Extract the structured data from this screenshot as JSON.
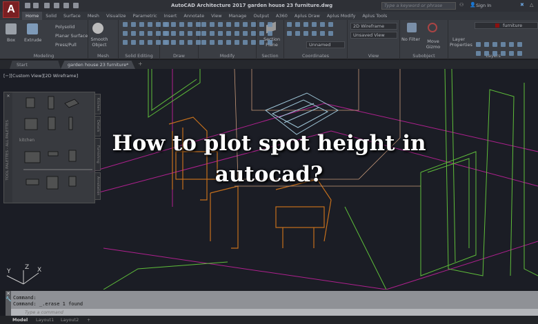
{
  "app": {
    "logo": "A",
    "title": "AutoCAD Architecture 2017   garden house 23 furniture.dwg",
    "search_placeholder": "Type a keyword or phrase",
    "sign_in": "Sign In"
  },
  "menu_tabs": [
    "Home",
    "Solid",
    "Surface",
    "Mesh",
    "Visualize",
    "Parametric",
    "Insert",
    "Annotate",
    "View",
    "Manage",
    "Output",
    "A360",
    "Aplus Draw",
    "Aplus Modify",
    "Aplus Tools"
  ],
  "ribbon": {
    "modeling": {
      "label": "Modeling",
      "box": "Box",
      "extrude": "Extrude",
      "polysolid": "Polysolid",
      "planar": "Planar Surface",
      "presspull": "Press/Pull"
    },
    "mesh": {
      "label": "Mesh",
      "smooth": "Smooth Object"
    },
    "solid_editing": {
      "label": "Solid Editing"
    },
    "draw": {
      "label": "Draw"
    },
    "modify": {
      "label": "Modify"
    },
    "section": {
      "label": "Section",
      "plane": "Section Plane"
    },
    "coordinates": {
      "label": "Coordinates",
      "ucs": "Unnamed"
    },
    "view": {
      "label": "View",
      "visual_style": "2D Wireframe",
      "named_view": "Unsaved View"
    },
    "subobject": {
      "label": "Subobject",
      "no_filter": "No Filter",
      "move_gizmo": "Move Gizmo"
    },
    "layers": {
      "label": "Layers",
      "properties": "Layer Properties",
      "current": "furniture",
      "current_color": "#8b1010"
    }
  },
  "file_tabs": [
    "Start",
    "garden house 23 furniture*"
  ],
  "viewport": {
    "label": "[−][Custom View][2D Wireframe]",
    "axes": [
      "Y",
      "Z",
      "X"
    ]
  },
  "palette": {
    "title": "TOOL PALETTES - ALL PALETTES",
    "section": "kitchen",
    "tabs": [
      "Kitchen",
      "Details",
      "Furnishing",
      "Annotation"
    ]
  },
  "headline": {
    "line1": "How to plot spot height in",
    "line2": "autocad?"
  },
  "command": {
    "history": [
      "Command:",
      "Command: _.erase 1 found"
    ],
    "placeholder": "Type a command"
  },
  "layout_tabs": [
    "Model",
    "Layout1",
    "Layout2",
    "+"
  ],
  "colors": {
    "magenta": "#b0208f",
    "green": "#5fbf3a",
    "orange": "#c6701c",
    "cyan": "#9fc6d8"
  }
}
